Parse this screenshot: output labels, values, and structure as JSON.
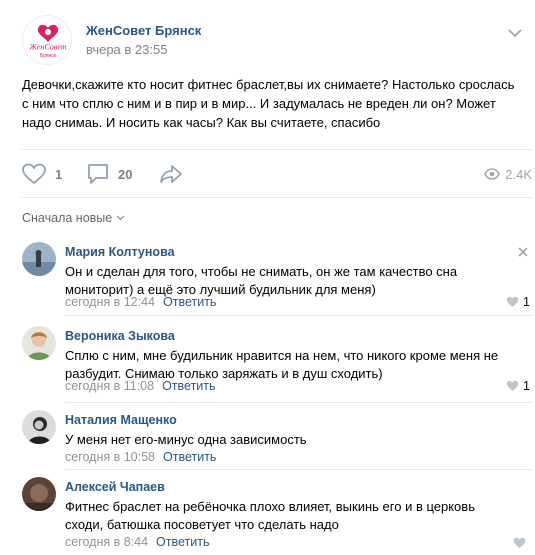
{
  "post": {
    "group_name": "ЖенСовет Брянск",
    "time": "вчера в 23:55",
    "logo_text": "ЖенСовет",
    "logo_subtext": "Брянск",
    "text": "Девочки,скажите кто носит фитнес браслет,вы их снимаете? Настолько срослась с ним что сплю с ним и в пир и в мир... И задумалась не вреден ли он? Может надо снимаь. И носить как часы? Как вы считаете, спасибо",
    "likes": "1",
    "comments": "20",
    "views": "2.4K"
  },
  "sort_label": "Сначала новые",
  "reply_label": "Ответить",
  "comments": [
    {
      "author": "Мария Колтунова",
      "text": "Он и сделан для того, чтобы не снимать, он же там качество сна мониторит) а ещё это лучший будильник для меня)",
      "time": "сегодня в 12:44",
      "likes": "1"
    },
    {
      "author": "Вероника Зыкова",
      "text": "Сплю с ним, мне будильник нравится на нем, что никого кроме меня не разбудит. Снимаю только заряжать и в душ сходить)",
      "time": "сегодня в 11:08",
      "likes": "1"
    },
    {
      "author": "Наталия Мащенко",
      "text": "У меня нет его-минус одна зависимость",
      "time": "сегодня в 10:58",
      "likes": ""
    },
    {
      "author": "Алексей Чапаев",
      "text": "Фитнес браслет на ребёночка плохо влияет, выкинь его и в церковь сходи, батюшка посоветует что сделать надо",
      "time": "сегодня в 8:44",
      "likes": ""
    }
  ],
  "colors": {
    "link": "#2a5885",
    "muted": "#828282",
    "divider": "#e7e8ec",
    "logo": "#d6245f"
  },
  "icons": [
    "heart-icon",
    "comment-icon",
    "share-icon",
    "eye-icon",
    "chevron-down-icon",
    "close-icon"
  ]
}
